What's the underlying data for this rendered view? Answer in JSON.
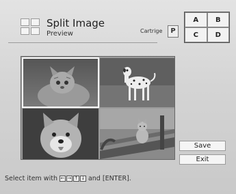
{
  "header": {
    "title": "Split Image",
    "subtitle": "Preview",
    "cartridge_label": "Cartrige",
    "cartridge_code": "P"
  },
  "layout_selector": {
    "cells": [
      "A",
      "B",
      "C",
      "D"
    ]
  },
  "preview": {
    "images": [
      "cat-kitten",
      "dalmatian-dog",
      "shiba-dog",
      "cat-on-bench"
    ]
  },
  "buttons": {
    "save": "Save",
    "exit": "Exit"
  },
  "hint": {
    "prefix": "Select item with",
    "keys": [
      "←",
      "→",
      "↑",
      "↓"
    ],
    "suffix": "and [ENTER]."
  }
}
